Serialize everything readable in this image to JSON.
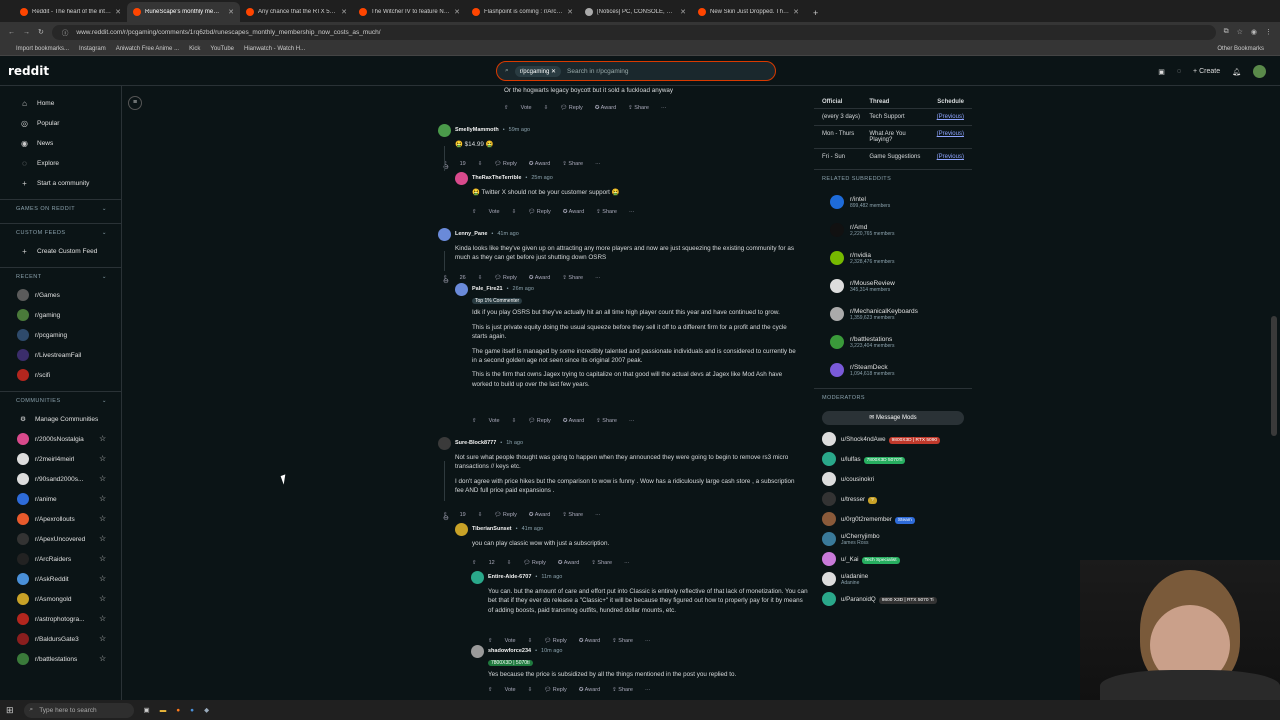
{
  "browser": {
    "tabs": [
      {
        "title": "Reddit - The heart of the intern",
        "color": "#ff4500"
      },
      {
        "title": "RuneScape's monthly members",
        "color": "#ff4500"
      },
      {
        "title": "Any chance that the RTX 5070",
        "color": "#ff4500"
      },
      {
        "title": "The Witcher IV to feature NVID",
        "color": "#ff4500"
      },
      {
        "title": "Flashpoint is coming : r/ArcRai",
        "color": "#ff4500"
      },
      {
        "title": "[Notices] PC, CONSOLE, MAC P",
        "color": "#aaaaaa"
      },
      {
        "title": "New Skin Just Dropped. Thoug",
        "color": "#ff4500"
      }
    ],
    "url": "www.reddit.com/r/pcgaming/comments/1rq6zbd/runescapes_monthly_membership_now_costs_as_much/",
    "bookmarks": [
      "Import bookmarks...",
      "Instagram",
      "Aniwatch Free Anime ...",
      "Kick",
      "YouTube",
      "Hianwatch - Watch H..."
    ],
    "other_bookmarks": "Other Bookmarks"
  },
  "header": {
    "logo": "reddit",
    "search_chip": "r/pcgaming",
    "search_placeholder": "Search in r/pcgaming",
    "create_label": "Create"
  },
  "left_nav": {
    "items": [
      {
        "label": "Home",
        "icon": "home-icon",
        "glyph": "⌂"
      },
      {
        "label": "Popular",
        "icon": "popular-icon",
        "glyph": "◎"
      },
      {
        "label": "News",
        "icon": "news-icon",
        "glyph": "◉"
      },
      {
        "label": "Explore",
        "icon": "explore-icon",
        "glyph": "◌"
      },
      {
        "label": "Start a community",
        "icon": "plus-icon",
        "glyph": "+"
      }
    ],
    "sections": {
      "games": "GAMES ON REDDIT",
      "custom": "CUSTOM FEEDS",
      "create_feed": "Create Custom Feed",
      "recent": "RECENT",
      "communities": "COMMUNITIES",
      "manage": "Manage Communities"
    },
    "recent": [
      {
        "name": "r/Games",
        "color": "#5b5b5b"
      },
      {
        "name": "r/gaming",
        "color": "#4a7a3a"
      },
      {
        "name": "r/pcgaming",
        "color": "#2e4a6b"
      },
      {
        "name": "r/LivestreamFail",
        "color": "#3b2d6b"
      },
      {
        "name": "r/scifi",
        "color": "#b3261e"
      }
    ],
    "communities": [
      {
        "name": "r/2000sNostalgia",
        "color": "#d94a8c"
      },
      {
        "name": "r/2meirl4meirl",
        "color": "#dddddd"
      },
      {
        "name": "r/90sand2000s...",
        "color": "#dddddd"
      },
      {
        "name": "r/anime",
        "color": "#2e6bd9"
      },
      {
        "name": "r/Apexrollouts",
        "color": "#e85a2c"
      },
      {
        "name": "r/ApexUncovered",
        "color": "#333333"
      },
      {
        "name": "r/ArcRaiders",
        "color": "#222222"
      },
      {
        "name": "r/AskReddit",
        "color": "#4a90d9"
      },
      {
        "name": "r/Asmongold",
        "color": "#c9a227"
      },
      {
        "name": "r/astrophotogra...",
        "color": "#b3261e"
      },
      {
        "name": "r/BaldursGate3",
        "color": "#8a1e1e"
      },
      {
        "name": "r/battlestations",
        "color": "#3a7a3a"
      }
    ]
  },
  "comments": [
    {
      "type": "text_only",
      "text": "Or the hogwarts legacy boycott but it sold a fuckload anyway"
    },
    {
      "user": "SmellyMammoth",
      "time": "59m ago",
      "flair": "",
      "text": [
        "🤮 $14.99 🤮"
      ],
      "votes": "19",
      "color": "#4a9a4a"
    },
    {
      "user": "TheRaxTheTerrible",
      "time": "25m ago",
      "flair": "",
      "text": [
        "🤮 Twitter X should not be your customer support 🤮"
      ],
      "votes": "",
      "color": "#d94a8c"
    },
    {
      "user": "Lenny_Pane",
      "time": "41m ago",
      "flair": "",
      "text": [
        "Kinda looks like they've given up on attracting any more players and now are just squeezing the existing community for as much as they can get before just shutting down OSRS"
      ],
      "votes": "26",
      "color": "#6a8ad9"
    },
    {
      "user": "Pale_Fire21",
      "time": "26m ago",
      "flair": "Top 1% Commenter",
      "text": [
        "Idk if you play OSRS but they've actually hit an all time high player count this year and have continued to grow.",
        "This is just private equity doing the usual squeeze before they sell it off to a different firm for a profit and the cycle starts again.",
        "The game itself is managed by some incredibly talented and passionate individuals and is considered to currently be in a second golden age not seen since its original 2007 peak.",
        "This is the firm that owns Jagex trying to capitalize on that good will the actual devs at Jagex like Mod Ash have worked to build up over the last few years."
      ],
      "votes": "",
      "color": "#6a8ad9"
    },
    {
      "user": "Sure-Block8777",
      "time": "1h ago",
      "flair": "",
      "text": [
        "Not sure what people thought was going to happen when they announced they were going to begin to remove rs3 micro transactions // keys etc.",
        "I don't agree with price hikes but the comparison to wow is funny . Wow has a ridiculously large cash store , a subscription fee AND full price paid expansions ."
      ],
      "votes": "19",
      "color": "#3a3a3a"
    },
    {
      "user": "TiberianSunset",
      "time": "41m ago",
      "flair": "",
      "text": [
        "you can play classic wow with just a subscription."
      ],
      "votes": "12",
      "color": "#c9a227"
    },
    {
      "user": "Entire-Aide-6707",
      "time": "11m ago",
      "flair": "",
      "text": [
        "You can. but the amount of care and effort put into Classic is entirely reflective of that lack of monetization. You can bet that if they ever do release a \"Classic+\" it will be because they figured out how to properly pay for it by means of adding boosts, paid transmog outfits, hundred dollar mounts, etc."
      ],
      "votes": "",
      "color": "#2aa88a"
    },
    {
      "user": "shadowforce234",
      "time": "10m ago",
      "flair": "7800X3D | 5070ti",
      "text": [
        "Yes because the price is subsidized by all the things mentioned in the post you replied to."
      ],
      "votes": "",
      "color": "#9a9a9a"
    }
  ],
  "actions": {
    "vote": "Vote",
    "reply": "Reply",
    "award": "Award",
    "share": "Share",
    "more": "···"
  },
  "sidebar": {
    "table_headers": [
      "Official",
      "Thread",
      "Schedule"
    ],
    "table_rows": [
      {
        "c1": "(every 3 days)",
        "c2": "Tech Support",
        "c3": "(Previous)"
      },
      {
        "c1": "Mon - Thurs",
        "c2": "What Are You Playing?",
        "c3": "(Previous)"
      },
      {
        "c1": "Fri - Sun",
        "c2": "Game Suggestions",
        "c3": "(Previous)"
      }
    ],
    "related_title": "RELATED SUBREDDITS",
    "related": [
      {
        "name": "r/intel",
        "members": "899,482 members",
        "color": "#1e6bd9"
      },
      {
        "name": "r/Amd",
        "members": "2,220,765 members",
        "color": "#111111"
      },
      {
        "name": "r/nvidia",
        "members": "2,328,476 members",
        "color": "#76b900"
      },
      {
        "name": "r/MouseReview",
        "members": "345,314 members",
        "color": "#dddddd"
      },
      {
        "name": "r/MechanicalKeyboards",
        "members": "1,359,623 members",
        "color": "#aaaaaa"
      },
      {
        "name": "r/battlestations",
        "members": "3,223,404 members",
        "color": "#3a9a3a"
      },
      {
        "name": "r/SteamDeck",
        "members": "1,094,618 members",
        "color": "#7a5ad9"
      }
    ],
    "moderators_title": "MODERATORS",
    "message_mods": "Message Mods",
    "mods": [
      {
        "name": "u/Shock4ndAwe",
        "flair": "9800X3D | RTX 5090",
        "flair_color": "#c0392b",
        "sub": "",
        "color": "#dddddd"
      },
      {
        "name": "u/lulfas",
        "flair": "7800X3D 5070Ti",
        "flair_color": "#27ae60",
        "sub": "",
        "color": "#2aa88a"
      },
      {
        "name": "u/cousinokri",
        "flair": "",
        "flair_color": "",
        "sub": "",
        "color": "#dddddd"
      },
      {
        "name": "u/tresser",
        "flair": "?",
        "flair_color": "#c9a227",
        "sub": "",
        "color": "#333333"
      },
      {
        "name": "u/0rg0t2remember",
        "flair": "Steam",
        "flair_color": "#2e6bd9",
        "sub": "",
        "color": "#8a5a3a"
      },
      {
        "name": "u/Cherryjimbo",
        "flair": "",
        "flair_color": "",
        "sub": "James Ross",
        "color": "#3a7a9a"
      },
      {
        "name": "u/_Kai",
        "flair": "Tech Specialist",
        "flair_color": "#27ae60",
        "sub": "",
        "color": "#c97ad9"
      },
      {
        "name": "u/adanine",
        "flair": "",
        "flair_color": "",
        "sub": "Adanine",
        "color": "#dddddd"
      },
      {
        "name": "u/ParanoidQ",
        "flair": "9800 X3D | RTX 5070 Ti",
        "flair_color": "#333333",
        "sub": "",
        "color": "#2aa88a"
      }
    ]
  },
  "taskbar": {
    "search_placeholder": "Type here to search"
  }
}
